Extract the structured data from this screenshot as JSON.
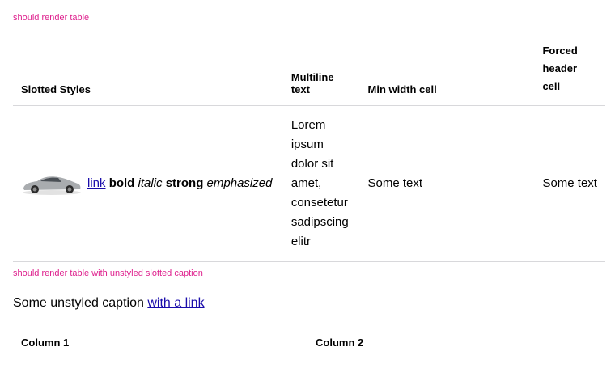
{
  "section1": {
    "title": "should render table"
  },
  "table1": {
    "headers": [
      "Slotted Styles",
      "Multiline text",
      "Min width cell",
      "Forced header cell"
    ],
    "row": {
      "image_icon": "car-image",
      "slotted": {
        "link": "link",
        "bold": "bold",
        "italic": "italic",
        "strong": "strong",
        "emphasized": "emphasized"
      },
      "multiline": "Lorem ipsum dolor sit amet, consetetur sadipscing elitr",
      "min_width": "Some text",
      "forced": "Some text"
    }
  },
  "section2": {
    "title": "should render table with unstyled slotted caption"
  },
  "table2": {
    "caption_text": "Some unstyled caption ",
    "caption_link": "with a link",
    "headers": [
      "Column 1",
      "Column 2"
    ]
  }
}
